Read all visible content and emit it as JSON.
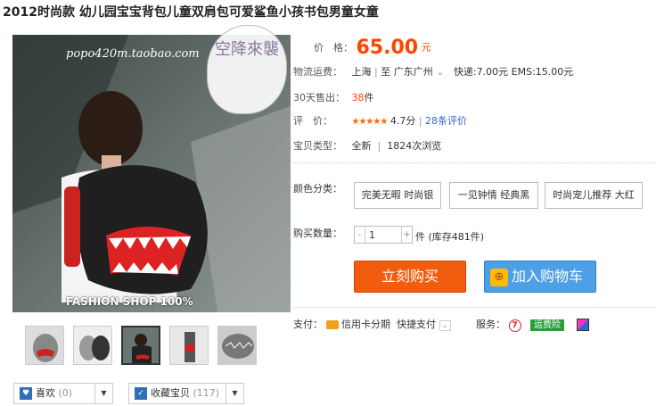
{
  "title": "2012时尚款 幼儿园宝宝背包儿童双肩包可爱鲨鱼小孩书包男童女童",
  "image": {
    "watermark": "popo420m.taobao.com",
    "banner": "FASHION SHOP 100%",
    "stamp": "空降來襲"
  },
  "price": {
    "label": "价　格：",
    "value": "65.00",
    "unit": "元"
  },
  "shipping": {
    "label": "物流运费：",
    "from": "上海",
    "to_sep": "至",
    "to": "广东广州",
    "express": "快递:7.00元",
    "ems": "EMS:15.00元"
  },
  "sold": {
    "label": "30天售出：",
    "value": "38",
    "unit": "件"
  },
  "rating": {
    "label": "评　价：",
    "stars": "★★★★★",
    "score": "4.7分",
    "reviews": "28条评价"
  },
  "type": {
    "label": "宝贝类型：",
    "value": "全新",
    "views": "1824次浏览"
  },
  "color": {
    "label": "颜色分类：",
    "options": [
      "完美无暇 时尚银",
      "一见钟情 经典黑",
      "时尚宠儿推荐 大红"
    ]
  },
  "qty": {
    "label": "购买数量：",
    "value": "1",
    "minus": "-",
    "plus": "+",
    "unit": "件",
    "stock": "(库存481件)"
  },
  "buttons": {
    "buy": "立刻购买",
    "cart": "加入购物车"
  },
  "payment": {
    "label": "支付：",
    "credit": "信用卡分期",
    "quick": "快捷支付",
    "service": "服务：",
    "insurance": "运费险",
    "seven": "7"
  },
  "favs": {
    "like": "喜欢",
    "like_count": "(0)",
    "collect": "收藏宝贝",
    "collect_count": "(117)"
  },
  "colors": {
    "accent": "#ff4400",
    "buy": "#f25c0e",
    "cart": "#4ea0e6",
    "link": "#3366cc"
  }
}
